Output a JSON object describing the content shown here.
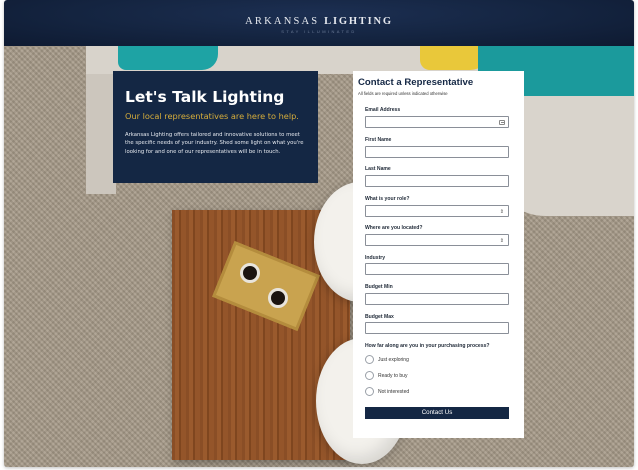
{
  "header": {
    "brand_light": "ARKANSAS",
    "brand_bold": "LIGHTING",
    "tagline": "STAY ILLUMINATED"
  },
  "hero": {
    "title": "Let's Talk Lighting",
    "subtitle": "Our local representatives are here to help.",
    "description": "Arkansas Lighting offers tailored and innovative solutions to meet the specific needs of your industry. Shed some light on what you're looking for and one of our representatives will be in touch."
  },
  "form": {
    "title": "Contact a Representative",
    "required_note": "All fields are required unless indicated otherwise",
    "fields": {
      "email": {
        "label": "Email Address",
        "value": ""
      },
      "first_name": {
        "label": "First Name",
        "value": ""
      },
      "last_name": {
        "label": "Last Name",
        "value": ""
      },
      "role": {
        "label": "What is your role?",
        "value": ""
      },
      "location": {
        "label": "Where are you located?",
        "value": ""
      },
      "industry": {
        "label": "Industry",
        "value": ""
      },
      "budget_min": {
        "label": "Budget Min",
        "value": ""
      },
      "budget_max": {
        "label": "Budget Max",
        "value": ""
      }
    },
    "process": {
      "label": "How far along are you in your purchasing process?",
      "options": [
        "Just exploring",
        "Ready to buy",
        "Not interested"
      ]
    },
    "submit_label": "Contact Us"
  },
  "icons": {
    "email_field": "contact-card-icon",
    "select": "chevron-updown-icon"
  },
  "colors": {
    "navy": "#142744",
    "gold": "#d6ad3b",
    "white": "#ffffff"
  }
}
